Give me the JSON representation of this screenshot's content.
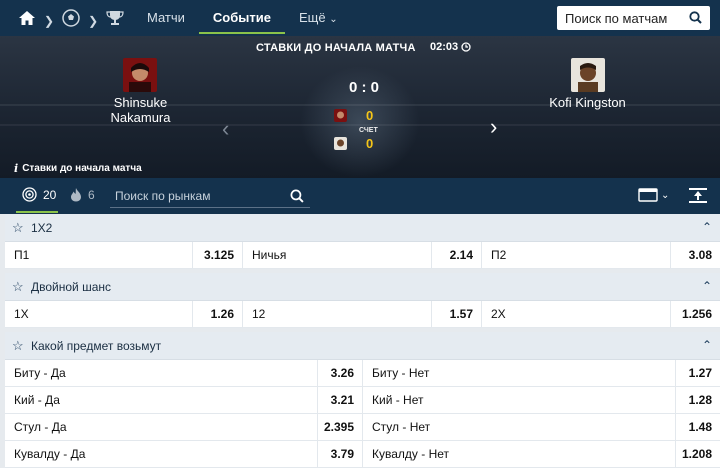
{
  "topbar": {
    "nav": [
      "Матчи",
      "Событие",
      "Ещё"
    ],
    "search_placeholder": "Поиск по матчам"
  },
  "event": {
    "status_title": "СТАВКИ ДО НАЧАЛА МАТЧА",
    "time": "02:03",
    "home": "Shinsuke Nakamura",
    "away": "Kofi Kingston",
    "score": "0 : 0",
    "home_score": "0",
    "away_score": "0",
    "score_label": "СЧЕТ",
    "info": "Ставки до начала матча"
  },
  "toolbar": {
    "all_count": "20",
    "live_count": "6",
    "search_placeholder": "Поиск по рынкам"
  },
  "markets": [
    {
      "title": "1X2",
      "rows": [
        [
          {
            "label": "П1",
            "odds": "3.125"
          },
          {
            "label": "Ничья",
            "odds": "2.14"
          },
          {
            "label": "П2",
            "odds": "3.08"
          }
        ]
      ]
    },
    {
      "title": "Двойной шанс",
      "rows": [
        [
          {
            "label": "1X",
            "odds": "1.26"
          },
          {
            "label": "12",
            "odds": "1.57"
          },
          {
            "label": "2X",
            "odds": "1.256"
          }
        ]
      ]
    },
    {
      "title": "Какой предмет возьмут",
      "rows": [
        [
          {
            "label": "Биту - Да",
            "odds": "3.26"
          },
          {
            "label": "Биту - Нет",
            "odds": "1.27"
          }
        ],
        [
          {
            "label": "Кий - Да",
            "odds": "3.21"
          },
          {
            "label": "Кий - Нет",
            "odds": "1.28"
          }
        ],
        [
          {
            "label": "Стул - Да",
            "odds": "2.395"
          },
          {
            "label": "Стул - Нет",
            "odds": "1.48"
          }
        ],
        [
          {
            "label": "Кувалду - Да",
            "odds": "3.79"
          },
          {
            "label": "Кувалду - Нет",
            "odds": "1.208"
          }
        ]
      ]
    }
  ],
  "icons": {
    "home": "home-icon",
    "soccer": "soccer-ball-icon",
    "trophy": "trophy-icon",
    "search": "search-icon",
    "clock": "clock-icon",
    "fire": "fire-icon",
    "target": "target-icon",
    "star": "star-icon",
    "collapse": "collapse-all-icon",
    "view": "view-mode-icon"
  },
  "colors": {
    "header_bg": "#14324d",
    "accent": "#8bc34a",
    "score_yellow": "#f5c518"
  }
}
